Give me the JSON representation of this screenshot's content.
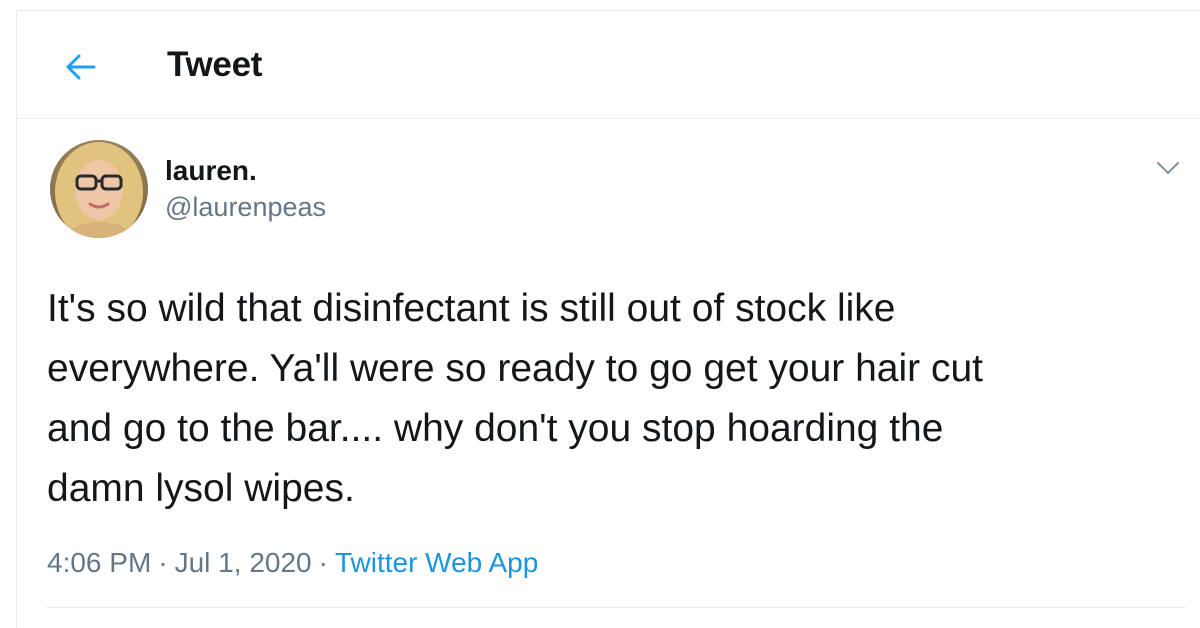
{
  "header": {
    "title": "Tweet",
    "back_icon": "arrow-left-icon"
  },
  "colors": {
    "accent": "#1b95e0",
    "secondary_text": "#657786",
    "divider": "#e6ecf0"
  },
  "tweet": {
    "author_name": "lauren.",
    "author_handle": "@laurenpeas",
    "text": "It's so wild that disinfectant is still out of stock like\neverywhere. Ya'll were so ready to go get your hair cut\nand go to the bar.... why don't you stop hoarding the\ndamn lysol wipes.",
    "time": "4:06 PM",
    "date": "Jul 1, 2020",
    "separator": "·",
    "source": "Twitter Web App",
    "menu_icon": "chevron-down-icon"
  }
}
